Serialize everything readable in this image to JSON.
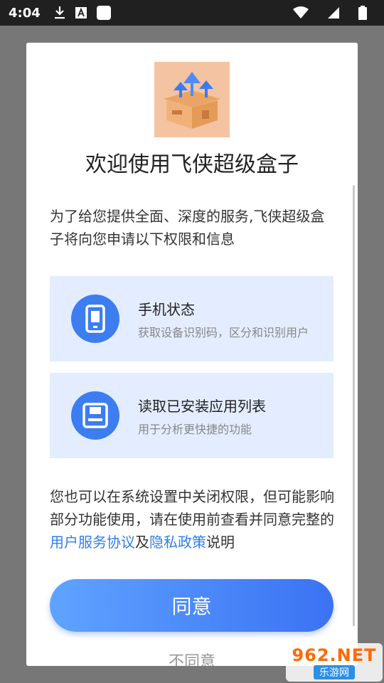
{
  "status_bar": {
    "time": "4:04",
    "icons": [
      "download-icon",
      "font-a-icon",
      "square-app-icon",
      "wifi-icon",
      "signal-icon",
      "battery-icon"
    ]
  },
  "dialog": {
    "title": "欢迎使用飞侠超级盒子",
    "intro": "为了给您提供全面、深度的服务,飞侠超级盒子将向您申请以下权限和信息",
    "permissions": [
      {
        "icon": "phone-icon",
        "title": "手机状态",
        "desc": "获取设备识别码，区分和识别用户"
      },
      {
        "icon": "storage-icon",
        "title": "读取已安装应用列表",
        "desc": "用于分析更快捷的功能"
      }
    ],
    "notice": {
      "before": "您也可以在系统设置中关闭权限，但可能影响部分功能使用，请在使用前查看并同意完整的",
      "link1": "用户服务协议",
      "middle": "及",
      "link2": "隐私政策",
      "after": "说明"
    },
    "agree_label": "同意",
    "disagree_label": "不同意"
  },
  "watermark": {
    "top": "962.NET",
    "bottom": "乐游网"
  },
  "colors": {
    "accent": "#3d7df2",
    "link": "#2f7ef0",
    "perm_bg": "#e3edff"
  }
}
